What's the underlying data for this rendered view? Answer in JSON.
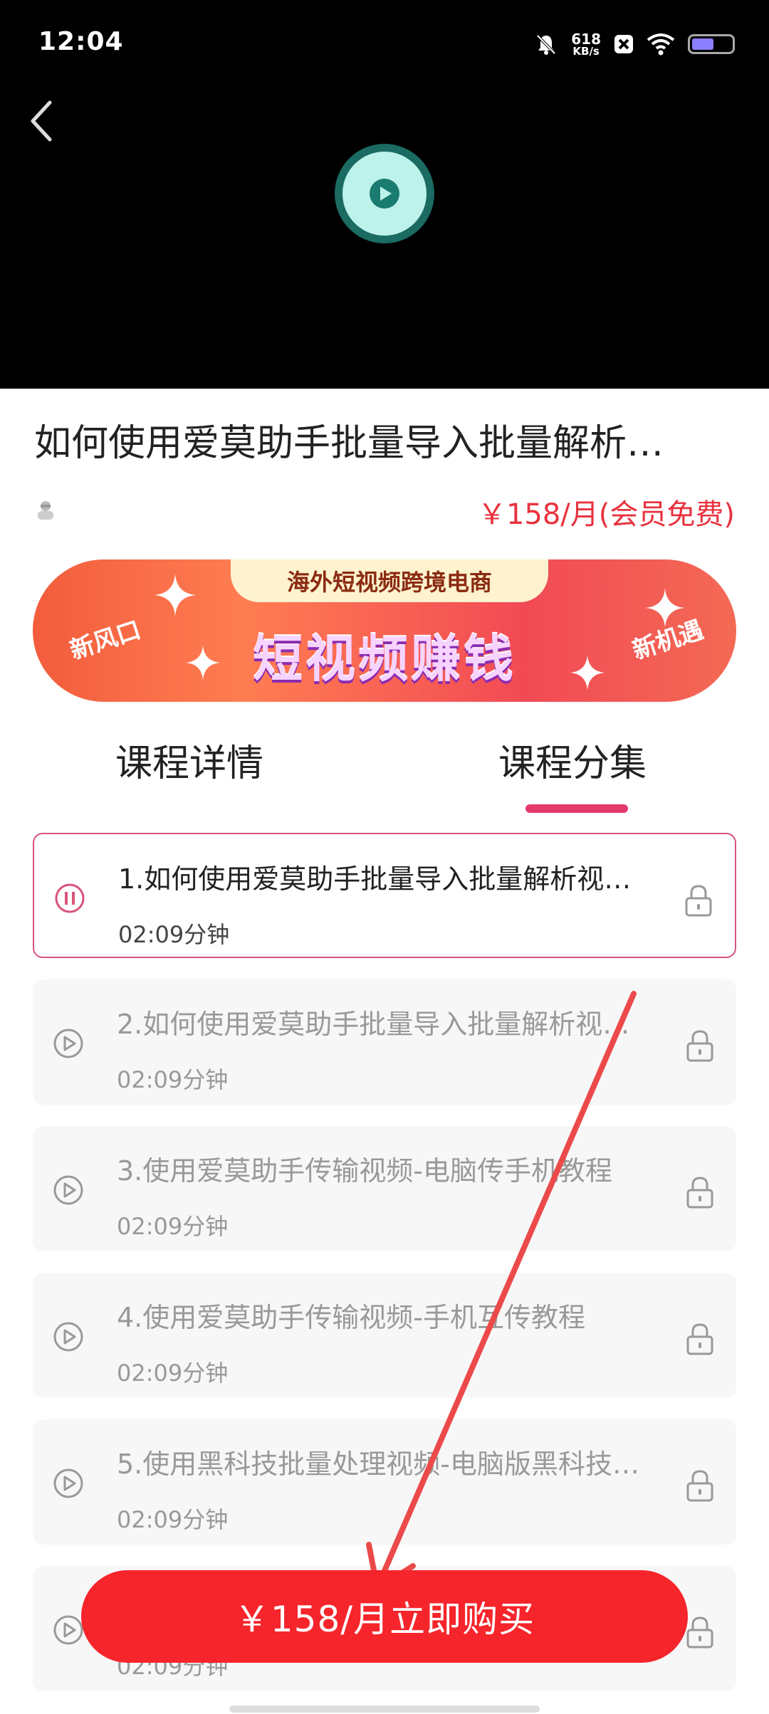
{
  "status_bar": {
    "time": "12:04",
    "net_speed_value": "618",
    "net_speed_unit": "KB/s"
  },
  "course": {
    "title": "如何使用爱莫助手批量导入批量解析…",
    "price": "￥158/月(会员免费)"
  },
  "banner": {
    "top_text": "海外短视频跨境电商",
    "main_text": "短视频赚钱",
    "left_tag": "新风口",
    "right_tag": "新机遇"
  },
  "tabs": {
    "details": "课程详情",
    "episodes": "课程分集"
  },
  "episodes": [
    {
      "title": "1.如何使用爱莫助手批量导入批量解析视…",
      "duration": "02:09分钟",
      "state": "playing"
    },
    {
      "title": "2.如何使用爱莫助手批量导入批量解析视…",
      "duration": "02:09分钟",
      "state": "locked"
    },
    {
      "title": "3.使用爱莫助手传输视频-电脑传手机教程",
      "duration": "02:09分钟",
      "state": "locked"
    },
    {
      "title": "4.使用爱莫助手传输视频-手机互传教程",
      "duration": "02:09分钟",
      "state": "locked"
    },
    {
      "title": "5.使用黑科技批量处理视频-电脑版黑科技…",
      "duration": "02:09分钟",
      "state": "locked"
    },
    {
      "title": "",
      "duration": "02:09分钟",
      "state": "locked"
    }
  ],
  "buy_button": {
    "label": "￥158/月立即购买"
  },
  "colors": {
    "accent_red": "#f5252b",
    "price_red": "#e8323e",
    "tab_underline": "#e43a6c",
    "annotation_arrow": "#ec4a4a"
  }
}
